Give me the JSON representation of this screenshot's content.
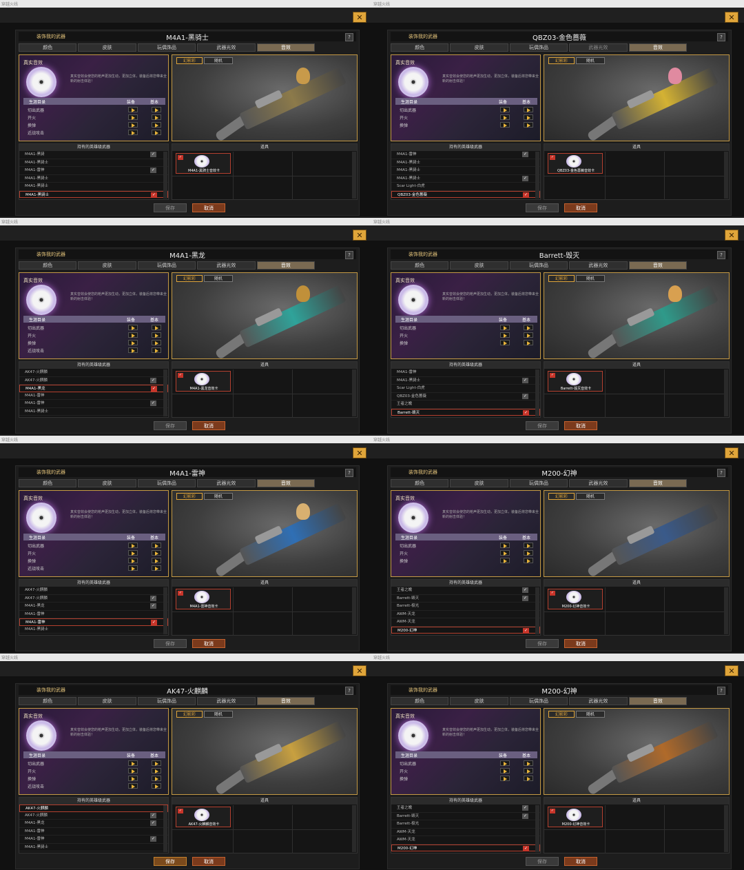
{
  "common": {
    "window_tag": "穿越火线",
    "header_label": "装饰我的武器",
    "tabs": [
      "颜色",
      "皮肤",
      "玩偶饰品",
      "武器光效",
      "音效"
    ],
    "section_title": "真实音效",
    "description": "真实音效会使您的枪声更加生动，更加立体，装备后将您带来全新的射击体验！",
    "ctl_header": "生涯目录",
    "ctl_col1": "装备",
    "ctl_col2": "基本",
    "ctl_rows": [
      "切出武器",
      "开火",
      "换弹",
      "近战攻击"
    ],
    "preview_tab1": "幻影彩",
    "preview_tab2": "随机",
    "hero_list_title": "持有的英雄级武器",
    "items_title": "道具",
    "save": "保存",
    "cancel": "取消",
    "close": "✕",
    "help": "?"
  },
  "panels": [
    {
      "title": "M4A1-黑骑士",
      "heroes": [
        "M4A1-黑骑",
        "M4A1-黑骑士",
        "M4A1-雷神",
        "M4A1-黑骑士",
        "M4A1-黑骑士",
        "M4A1-黑骑士"
      ],
      "checks": [
        "gray",
        "",
        "gray",
        "",
        "",
        "red"
      ],
      "selected": 5,
      "card": "M4A1-黑骑士音效卡",
      "ctl_rows": 4,
      "save_on": false,
      "gun_color": "#8c7a4a",
      "chibi_color": "#c89a4a"
    },
    {
      "title": "QBZ03-金色蔷薇",
      "heroes": [
        "M4A1-雷神",
        "M4A1-黑骑士",
        "M4A1-黑骑士",
        "M4A1-黑骑士",
        "Scar Light-白虎",
        "QBZ03-金色蔷薇"
      ],
      "checks": [
        "gray",
        "",
        "",
        "gray",
        "",
        "red"
      ],
      "selected": 5,
      "card": "QBZ03-金色蔷薇音效卡",
      "ctl_rows": 3,
      "save_on": false,
      "gun_color": "#d4b233",
      "chibi_color": "#e08aa0",
      "dim_tab": 3
    },
    {
      "title": "M4A1-黑龙",
      "heroes": [
        "AK47-火麒麟",
        "AK47-火麒麟",
        "M4A1-黑龙",
        "M4A1-雷神",
        "M4A1-雷神",
        "M4A1-黑骑士"
      ],
      "checks": [
        "",
        "gray",
        "red",
        "",
        "gray",
        ""
      ],
      "selected": 2,
      "card": "M4A1-黑龙音效卡",
      "ctl_rows": 4,
      "save_on": false,
      "gun_color": "#2fa39a",
      "chibi_color": "#c0903a"
    },
    {
      "title": "Barrett-毁灭",
      "heroes": [
        "M4A1-雷神",
        "M4A1-黑骑士",
        "Scar Light-白虎",
        "QBZ03-金色蔷薇",
        "王者之魄",
        "Barrett-毁灭"
      ],
      "checks": [
        "",
        "gray",
        "",
        "gray",
        "",
        "red"
      ],
      "selected": 5,
      "card": "Barrett-毁灭音效卡",
      "ctl_rows": 3,
      "save_on": false,
      "gun_color": "#2f9a8a",
      "chibi_color": "#d8a050"
    },
    {
      "title": "M4A1-雷神",
      "heroes": [
        "AK47-火麒麟",
        "AK47-火麒麟",
        "M4A1-黑龙",
        "M4A1-雷神",
        "M4A1-雷神",
        "M4A1-黑骑士"
      ],
      "checks": [
        "",
        "gray",
        "gray",
        "",
        "red",
        ""
      ],
      "selected": 4,
      "card": "M4A1-雷神音效卡",
      "ctl_rows": 4,
      "save_on": false,
      "gun_color": "#2f6fb5",
      "chibi_color": "#d8b070"
    },
    {
      "title": "M200-幻神",
      "heroes": [
        "王者之魄",
        "Barrett-毁灭",
        "Barrett-极光",
        "AWM-天龙",
        "AWM-天龙",
        "M200-幻神"
      ],
      "checks": [
        "gray",
        "gray",
        "",
        "",
        "",
        "red"
      ],
      "selected": 5,
      "card": "M200-幻神音效卡",
      "ctl_rows": 3,
      "save_on": false,
      "gun_color": "#3a5a8a",
      "chibi_color": ""
    },
    {
      "title": "AK47-火麒麟",
      "heroes": [
        "AK47-火麒麟",
        "AK47-火麒麟",
        "M4A1-黑龙",
        "M4A1-雷神",
        "M4A1-雷神",
        "M4A1-黑骑士"
      ],
      "checks": [
        "",
        "gray",
        "gray",
        "",
        "gray",
        ""
      ],
      "selected": 0,
      "card": "AK47-火麒麟音效卡",
      "ctl_rows": 4,
      "save_on": true,
      "gun_color": "#c8a040",
      "chibi_color": ""
    },
    {
      "title": "M200-幻神",
      "heroes": [
        "王者之魄",
        "Barrett-毁灭",
        "Barrett-极光",
        "AWM-天龙",
        "AWM-天龙",
        "M200-幻神"
      ],
      "checks": [
        "gray",
        "gray",
        "",
        "",
        "",
        "red"
      ],
      "selected": 5,
      "card": "M200-幻神音效卡",
      "ctl_rows": 3,
      "save_on": false,
      "gun_color": "#b06a2a",
      "chibi_color": ""
    }
  ]
}
